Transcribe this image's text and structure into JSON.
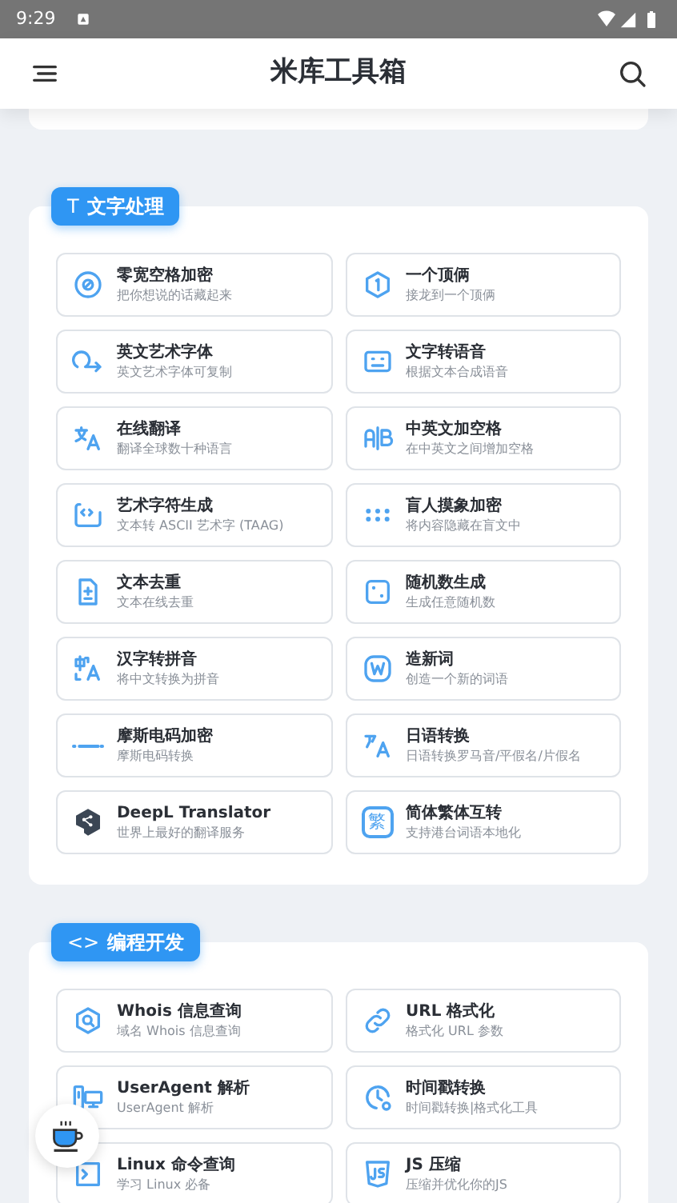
{
  "status_bar": {
    "time": "9:29"
  },
  "app_bar": {
    "title": "米库工具箱"
  },
  "sections": [
    {
      "title": "文字处理",
      "icon": "T",
      "items": [
        {
          "title": "零宽空格加密",
          "subtitle": "把你想说的话藏起来"
        },
        {
          "title": "一个顶俩",
          "subtitle": "接龙到一个顶俩"
        },
        {
          "title": "英文艺术字体",
          "subtitle": "英文艺术字体可复制"
        },
        {
          "title": "文字转语音",
          "subtitle": "根据文本合成语音"
        },
        {
          "title": "在线翻译",
          "subtitle": "翻译全球数十种语言"
        },
        {
          "title": "中英文加空格",
          "subtitle": "在中英文之间增加空格"
        },
        {
          "title": "艺术字符生成",
          "subtitle": "文本转 ASCII 艺术字 (TAAG)"
        },
        {
          "title": "盲人摸象加密",
          "subtitle": "将内容隐藏在盲文中"
        },
        {
          "title": "文本去重",
          "subtitle": "文本在线去重"
        },
        {
          "title": "随机数生成",
          "subtitle": "生成任意随机数"
        },
        {
          "title": "汉字转拼音",
          "subtitle": "将中文转换为拼音"
        },
        {
          "title": "造新词",
          "subtitle": "创造一个新的词语"
        },
        {
          "title": "摩斯电码加密",
          "subtitle": "摩斯电码转换"
        },
        {
          "title": "日语转换",
          "subtitle": "日语转换罗马音/平假名/片假名"
        },
        {
          "title": "DeepL Translator",
          "subtitle": "世界上最好的翻译服务"
        },
        {
          "title": "简体繁体互转",
          "subtitle": "支持港台词语本地化",
          "icon_text": "繁"
        }
      ]
    },
    {
      "title": "编程开发",
      "icon": "<>",
      "items": [
        {
          "title": "Whois 信息查询",
          "subtitle": "域名 Whois 信息查询"
        },
        {
          "title": "URL 格式化",
          "subtitle": "格式化 URL 参数"
        },
        {
          "title": "UserAgent 解析",
          "subtitle": "UserAgent 解析"
        },
        {
          "title": "时间戳转换",
          "subtitle": "时间戳转换|格式化工具"
        },
        {
          "title": "Linux 命令查询",
          "subtitle": "学习 Linux 必备"
        },
        {
          "title": "JS 压缩",
          "subtitle": "压缩并优化你的JS"
        }
      ]
    }
  ]
}
